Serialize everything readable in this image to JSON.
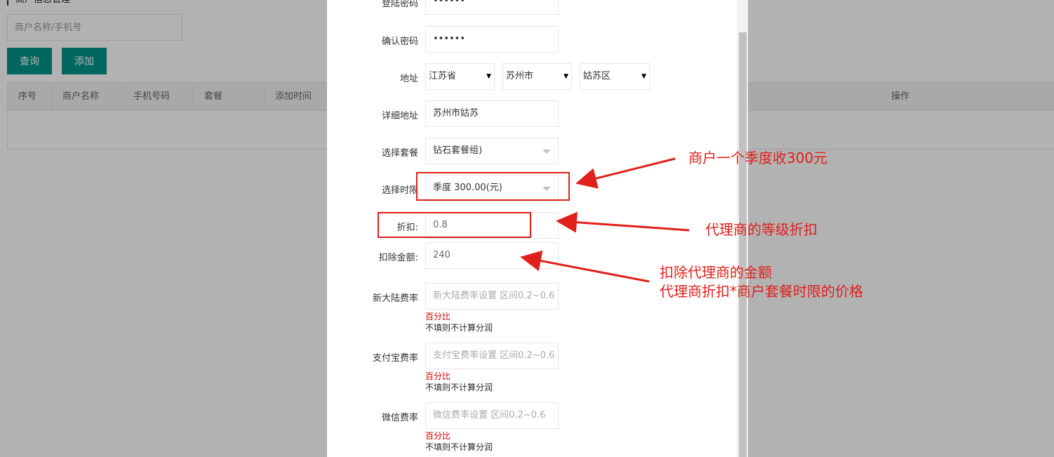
{
  "background": {
    "section_title": "商户信息管理",
    "search_placeholder": "商户名称/手机号",
    "query_button": "查询",
    "add_button": "添加",
    "table_headers": [
      "序号",
      "商户名称",
      "手机号码",
      "套餐",
      "添加时间",
      "操作"
    ]
  },
  "form": {
    "login_password_label": "登陆密码",
    "login_password_value": "••••••",
    "confirm_password_label": "确认密码",
    "confirm_password_value": "••••••",
    "address_label": "地址",
    "province": "江苏省",
    "city": "苏州市",
    "district": "姑苏区",
    "detail_address_label": "详细地址",
    "detail_address_value": "苏州市姑苏",
    "package_label": "选择套餐",
    "package_value": "钻石套餐组)",
    "term_label": "选择时限",
    "term_value": "季度  300.00(元)",
    "discount_label": "折扣:",
    "discount_value": "0.8",
    "deduct_label": "扣除金额:",
    "deduct_value": "240",
    "mainland_rate_label": "新大陆费率",
    "mainland_rate_placeholder": "新大陆费率设置 区间0.2~0.6",
    "alipay_rate_label": "支付宝费率",
    "alipay_rate_placeholder": "支付宝费率设置 区间0.2~0.6",
    "wechat_rate_label": "微信费率",
    "wechat_rate_placeholder": "微信费率设置 区间0.2~0.6",
    "percent_tip": "百分比",
    "no_profit_tip": "不填则不计算分润"
  },
  "annotations": {
    "note_quarter_fee": "商户一个季度收300元",
    "note_agent_discount": "代理商的等级折扣",
    "note_deduct_line1": "扣除代理商的金额",
    "note_deduct_line2": "代理商折扣*商户套餐时限的价格",
    "color": "#e0201a"
  },
  "colors": {
    "primary_button": "#009688",
    "tip_red": "#cc0000"
  }
}
